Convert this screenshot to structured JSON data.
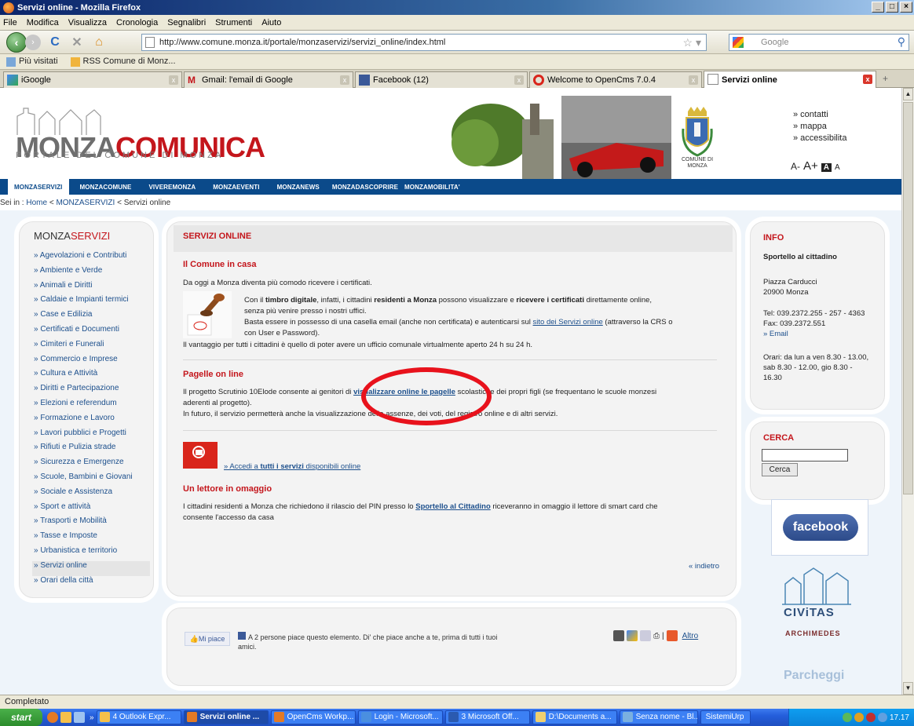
{
  "window": {
    "title": "Servizi online - Mozilla Firefox",
    "controls": [
      "_",
      "\u0006",
      "X"
    ]
  },
  "menu": [
    "File",
    "Modifica",
    "Visualizza",
    "Cronologia",
    "Segnalibri",
    "Strumenti",
    "Aiuto"
  ],
  "toolbar": {
    "url": "http://www.comune.monza.it/portale/monzaservizi/servizi_online/index.html",
    "search_placeholder": "Google"
  },
  "bookmarks": [
    "Più visitati",
    "RSS Comune di Monz..."
  ],
  "tabs": [
    {
      "label": "iGoogle",
      "active": false
    },
    {
      "label": "Gmail: l'email di Google",
      "active": false
    },
    {
      "label": "Facebook (12)",
      "active": false
    },
    {
      "label": "Welcome to OpenCms 7.0.4",
      "active": false
    },
    {
      "label": "Servizi online",
      "active": true
    }
  ],
  "header": {
    "logo_a": "MONZA",
    "logo_b": "COMUNICA",
    "logo_sub": "PORTALE DEL COMUNE DI MONZA",
    "crest_text": "COMUNE DI MONZA",
    "toplinks": [
      "» contatti",
      "» mappa",
      "» accessibilita"
    ],
    "fontsize": {
      "small": "A-",
      "big": "A+",
      "box": "A",
      "plain": "A"
    }
  },
  "nav": [
    "MONZASERVIZI",
    "MONZACOMUNE",
    "VIVEREMONZA",
    "MONZAEVENTI",
    "MONZANEWS",
    "MONZADASCOPRIRE",
    "MONZAMOBILITA'"
  ],
  "breadcrumb": {
    "prefix": "Sei in :",
    "home": "Home",
    "sep1": "<",
    "level1": "MONZASERVIZI",
    "sep2": "<",
    "current": "Servizi online"
  },
  "sidebar": {
    "title_a": "MONZA",
    "title_b": "SERVIZI",
    "items": [
      "» Agevolazioni e Contributi",
      "» Ambiente e Verde",
      "» Animali e Diritti",
      "» Caldaie e Impianti termici",
      "» Case e Edilizia",
      "» Certificati e Documenti",
      "» Cimiteri e Funerali",
      "» Commercio e Imprese",
      "» Cultura e Attività",
      "» Diritti e Partecipazione",
      "» Elezioni e referendum",
      "» Formazione e Lavoro",
      "» Lavori pubblici e Progetti",
      "» Rifiuti e Pulizia strade",
      "» Sicurezza e Emergenze",
      "» Scuole, Bambini e Giovani",
      "» Sociale e Assistenza",
      "» Sport e attività",
      "» Trasporti e Mobilità",
      "» Tasse e Imposte",
      "» Urbanistica e territorio",
      "» Servizi online",
      "» Orari della città"
    ]
  },
  "main": {
    "title": "SERVIZI ONLINE",
    "s1_title": "Il Comune in casa",
    "s1_intro": "Da oggi a Monza diventa più comodo ricevere i certificati.",
    "s1_p1_a": "Con il ",
    "s1_p1_b": "timbro digitale",
    "s1_p1_c": ", infatti, i cittadini ",
    "s1_p1_d": "residenti a Monza",
    "s1_p1_e": " possono visualizzare e ",
    "s1_p1_f": "ricevere i certificati",
    "s1_p1_g": " direttamente online,",
    "s1_p2": "senza più venire presso i nostri uffici.",
    "s1_p3_a": "Basta essere in possesso di una casella email (anche non certificata) e autenticarsi sul ",
    "s1_p3_link": "sito dei Servizi online",
    "s1_p3_b": " (attraverso la CRS o",
    "s1_p4": "con User e Password).",
    "s1_p5": "Il vantaggio per tutti i cittadini è quello di poter avere un ufficio comunale virtualmente aperto 24 h su 24 h.",
    "s2_title": "Pagelle on line",
    "s2_p1_a": "Il progetto Scrutinio 10Elode consente ai genitori di ",
    "s2_p1_link": "visualizzare online le pagelle",
    "s2_p1_b": " scolastiche dei propri figli (se frequentano le scuole monzesi",
    "s2_p2": "aderenti al progetto).",
    "s2_p3": "In futuro, il servizio permetterà anche la visualizzazione delle assenze, dei voti, del registro online e di altri servizi.",
    "access_a": "» Accedi a ",
    "access_b": "tutti i servizi",
    "access_c": " disponibili online",
    "s3_title": "Un lettore in omaggio",
    "s3_p1_a": "I cittadini residenti a Monza che richiedono il rilascio del PIN  presso lo ",
    "s3_p1_link": "Sportello al Cittadino",
    "s3_p1_b": " riceveranno in omaggio il lettore di smart card che",
    "s3_p2": "consente l'accesso da casa",
    "back": "« indietro"
  },
  "info": {
    "title": "INFO",
    "office": "Sportello al cittadino",
    "addr1": "Piazza Carducci",
    "addr2": "20900 Monza",
    "tel": "Tel: 039.2372.255 - 257 - 4363",
    "fax": "Fax: 039.2372.551",
    "email": "» Email",
    "hours1": "Orari: da lun a ven 8.30 - 13.00,",
    "hours2": "sab 8.30 - 12.00, gio 8.30 -",
    "hours3": "16.30"
  },
  "search": {
    "title": "CERCA",
    "button": "Cerca"
  },
  "ads": {
    "facebook": "facebook",
    "civitas": "CIViTAS",
    "archimedes": "ARCHIMEDES",
    "parcheggi": "Parcheggi"
  },
  "social": {
    "like": "Mi piace",
    "like_text": "A 2 persone piace questo elemento. Di' che piace anche a te, prima di tutti i tuoi amici.",
    "altro": "Altro"
  },
  "status": "Completato",
  "taskbar": {
    "start": "start",
    "items": [
      "4 Outlook Expr...",
      "Servizi online ...",
      "OpenCms Workp...",
      "Login - Microsoft...",
      "3 Microsoft Off...",
      "D:\\Documents a...",
      "Senza nome - Bl...",
      "SistemiUrp"
    ],
    "clock": "17.17"
  }
}
